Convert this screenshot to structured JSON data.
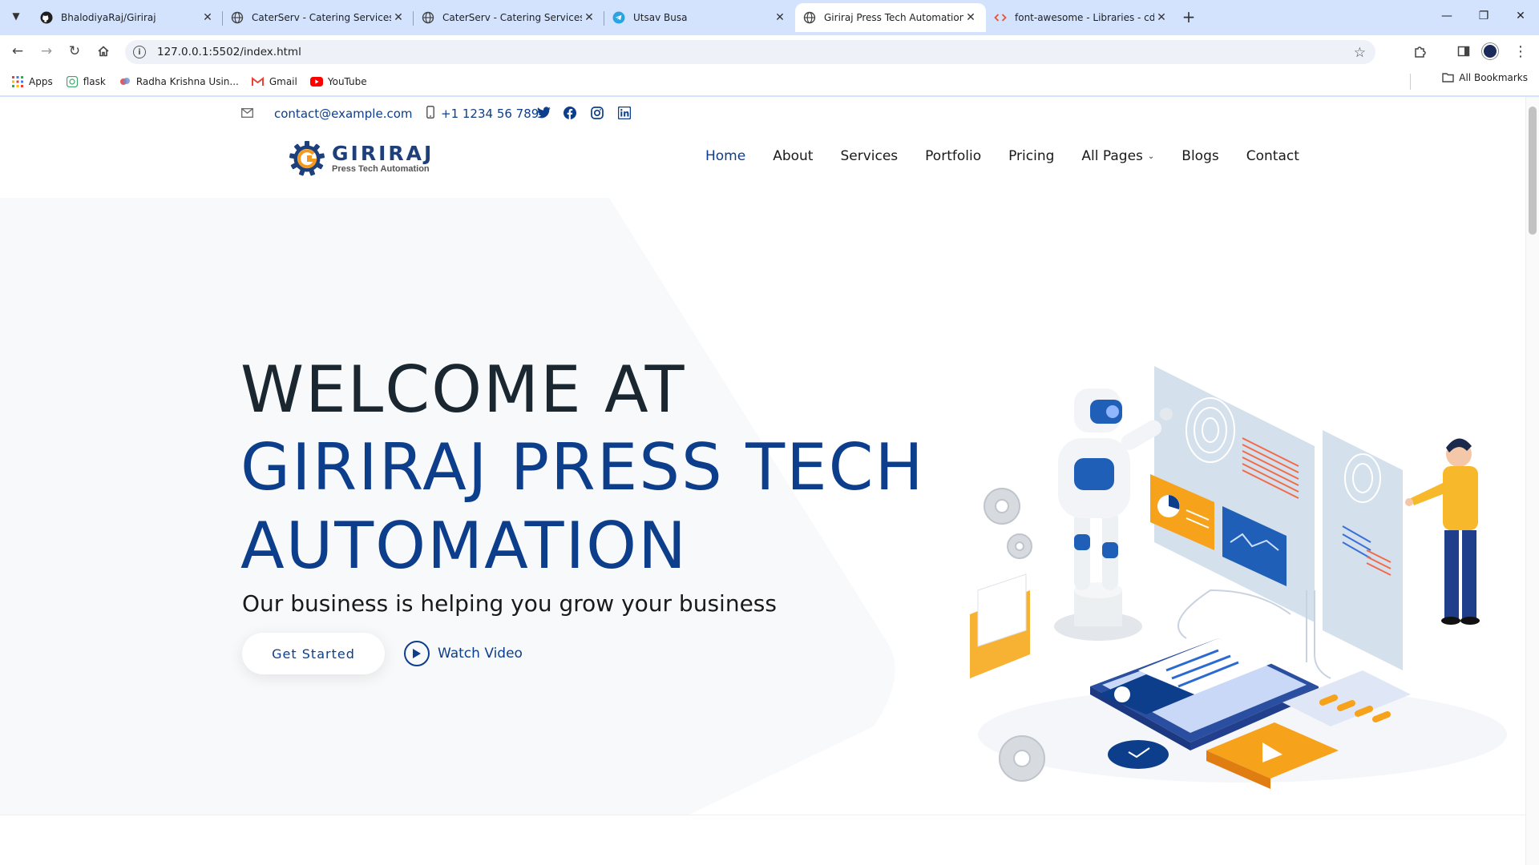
{
  "browser": {
    "tabs": [
      {
        "title": "BhalodiyaRaj/Giriraj",
        "favicon": "github-icon"
      },
      {
        "title": "CaterServ - Catering Services W",
        "favicon": "globe-icon"
      },
      {
        "title": "CaterServ - Catering Services W",
        "favicon": "globe-icon"
      },
      {
        "title": "Utsav Busa",
        "favicon": "telegram-icon"
      },
      {
        "title": "Giriraj Press Tech Automation",
        "favicon": "globe-icon",
        "active": true
      },
      {
        "title": "font-awesome - Libraries - cdnj",
        "favicon": "code-icon"
      }
    ],
    "url": "127.0.0.1:5502/index.html",
    "bookmarks": [
      {
        "label": "Apps",
        "icon": "apps-grid-icon"
      },
      {
        "label": "flask",
        "icon": "flask-icon"
      },
      {
        "label": "Radha Krishna Usin...",
        "icon": "bookmark-favicon"
      },
      {
        "label": "Gmail",
        "icon": "gmail-icon"
      },
      {
        "label": "YouTube",
        "icon": "youtube-icon"
      }
    ],
    "all_bookmarks": "All Bookmarks"
  },
  "topbar": {
    "email": "contact@example.com",
    "phone": "+1 1234 56 789",
    "socials": [
      "twitter-icon",
      "facebook-icon",
      "instagram-icon",
      "linkedin-icon"
    ]
  },
  "logo": {
    "name": "GIRIRAJ",
    "subtitle": "Press Tech Automation"
  },
  "nav": {
    "items": [
      {
        "label": "Home",
        "active": true
      },
      {
        "label": "About"
      },
      {
        "label": "Services"
      },
      {
        "label": "Portfolio"
      },
      {
        "label": "Pricing"
      },
      {
        "label": "All Pages",
        "dropdown": true
      },
      {
        "label": "Blogs"
      },
      {
        "label": "Contact"
      }
    ]
  },
  "hero": {
    "line1": "WELCOME AT",
    "line2": "GIRIRAJ PRESS TECH",
    "line3": "AUTOMATION",
    "tagline": "Our business is helping you grow your business",
    "cta_primary": "Get Started",
    "cta_video": "Watch Video"
  },
  "colors": {
    "brand_blue": "#0d3e8c",
    "heading_dark": "#1a2730",
    "chrome_bg": "#d3e3fd",
    "accent_orange": "#f7a21b"
  }
}
